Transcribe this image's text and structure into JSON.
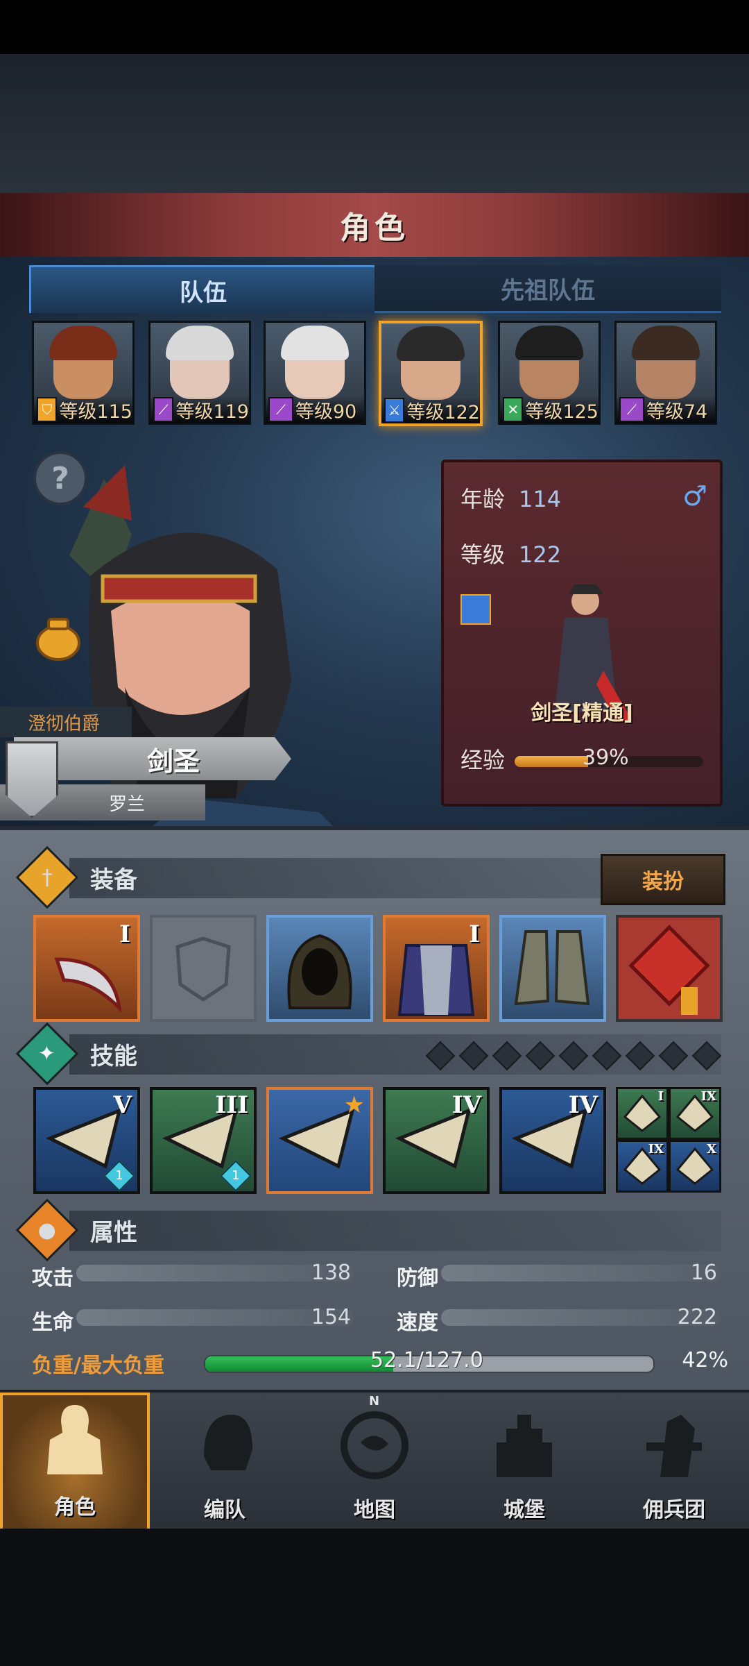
{
  "header": {
    "title": "角色"
  },
  "tabs": [
    {
      "label": "队伍",
      "active": true
    },
    {
      "label": "先祖队伍",
      "active": false
    }
  ],
  "team": [
    {
      "level": "等级115",
      "class_color": "#f1a42a",
      "class_icon": "shield-icon",
      "skin": "#c98f62",
      "hair": "#7a2e1a"
    },
    {
      "level": "等级119",
      "class_color": "#9a4ac8",
      "class_icon": "staff-icon",
      "skin": "#e2c7b8",
      "hair": "#d9d9d9"
    },
    {
      "level": "等级90",
      "class_color": "#9a4ac8",
      "class_icon": "staff-icon",
      "skin": "#e6c9b7",
      "hair": "#e2e2e2"
    },
    {
      "level": "等级122",
      "class_color": "#3a7ad8",
      "class_icon": "sword-icon",
      "skin": "#d7a88a",
      "hair": "#2a2a2a",
      "selected": true
    },
    {
      "level": "等级125",
      "class_color": "#3aa85a",
      "class_icon": "crossed-blades-icon",
      "skin": "#b98462",
      "hair": "#1e1e1e"
    },
    {
      "level": "等级74",
      "class_color": "#9a4ac8",
      "class_icon": "staff-icon",
      "skin": "#b58366",
      "hair": "#3a2a22"
    }
  ],
  "hero": {
    "title": "澄彻伯爵",
    "class_name": "剑圣",
    "name": "罗兰"
  },
  "info": {
    "age_label": "年龄",
    "age": "114",
    "level_label": "等级",
    "level": "122",
    "class_full": "剑圣[精通]",
    "exp_label": "经验",
    "exp_percent": 39,
    "exp_text": "39%",
    "gender_icon": "♂"
  },
  "equipment": {
    "label": "装备",
    "dress_button": "装扮",
    "slots": [
      {
        "kind": "weapon",
        "rarity": "orange",
        "tier": "I"
      },
      {
        "kind": "empty",
        "rarity": "empty",
        "tier": ""
      },
      {
        "kind": "hood",
        "rarity": "blue",
        "tier": ""
      },
      {
        "kind": "armor",
        "rarity": "orange",
        "tier": "I"
      },
      {
        "kind": "boots",
        "rarity": "blue",
        "tier": ""
      },
      {
        "kind": "charm",
        "rarity": "red",
        "tier": ""
      }
    ]
  },
  "skills": {
    "label": "技能",
    "items": [
      {
        "tier": "V",
        "color": "blue",
        "badge": "1"
      },
      {
        "tier": "III",
        "color": "green",
        "badge": "1"
      },
      {
        "tier": "",
        "color": "gold",
        "badge": ""
      },
      {
        "tier": "IV",
        "color": "green",
        "badge": ""
      },
      {
        "tier": "IV",
        "color": "blue",
        "badge": ""
      }
    ],
    "mini": [
      {
        "tier": "I",
        "color": "green"
      },
      {
        "tier": "IX",
        "color": "green"
      },
      {
        "tier": "IX",
        "color": "blue"
      },
      {
        "tier": "X",
        "color": "blue"
      }
    ]
  },
  "attributes": {
    "label": "属性",
    "attack_label": "攻击",
    "attack": "138",
    "defense_label": "防御",
    "defense": "16",
    "hp_label": "生命",
    "hp": "154",
    "speed_label": "速度",
    "speed": "222",
    "load_label": "负重/最大负重",
    "load_text": "52.1/127.0",
    "load_percent": 42,
    "load_pct_text": "42%"
  },
  "nav": [
    {
      "label": "角色",
      "active": true
    },
    {
      "label": "编队",
      "active": false
    },
    {
      "label": "地图",
      "active": false,
      "compass": "N"
    },
    {
      "label": "城堡",
      "active": false
    },
    {
      "label": "佣兵团",
      "active": false
    }
  ],
  "colors": {
    "accent": "#f0a22a",
    "tab_blue": "#4a8ad2",
    "load_green": "#34c05a"
  }
}
